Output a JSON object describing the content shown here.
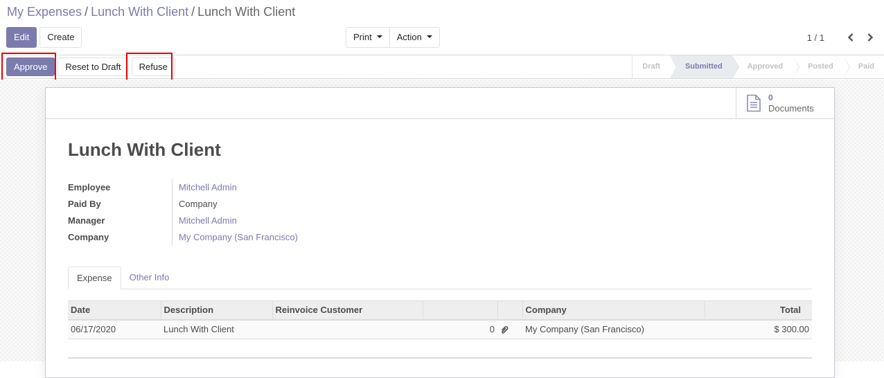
{
  "breadcrumb": {
    "items": [
      "My Expenses",
      "Lunch With Client"
    ],
    "separator": "/",
    "active": "Lunch With Client"
  },
  "control": {
    "edit_label": "Edit",
    "create_label": "Create",
    "print_label": "Print",
    "action_label": "Action",
    "pager_value": "1 / 1"
  },
  "statusbar": {
    "approve_label": "Approve",
    "reset_label": "Reset to Draft",
    "refuse_label": "Refuse",
    "stages": [
      "Draft",
      "Submitted",
      "Approved",
      "Posted",
      "Paid"
    ],
    "current_stage": "Submitted",
    "highlight_color": "#ee0000"
  },
  "smart_button": {
    "value": "0",
    "label": "Documents"
  },
  "record": {
    "title": "Lunch With Client",
    "fields": [
      {
        "label": "Employee",
        "value": "Mitchell Admin",
        "link": true
      },
      {
        "label": "Paid By",
        "value": "Company",
        "link": false
      },
      {
        "label": "Manager",
        "value": "Mitchell Admin",
        "link": true
      },
      {
        "label": "Company",
        "value": "My Company (San Francisco)",
        "link": true
      }
    ]
  },
  "tabs": [
    {
      "label": "Expense",
      "active": true
    },
    {
      "label": "Other Info",
      "active": false
    }
  ],
  "lines": {
    "headers": [
      "Date",
      "Description",
      "Reinvoice Customer",
      "",
      "",
      "Company",
      "Total"
    ],
    "rows": [
      {
        "date": "06/17/2020",
        "description": "Lunch With Client",
        "reinvoice_customer": "",
        "attachments": "0",
        "company": "My Company (San Francisco)",
        "total": "$ 300.00"
      }
    ]
  },
  "colors": {
    "primary": "#7c7bad",
    "text": "#4c4c4c"
  }
}
